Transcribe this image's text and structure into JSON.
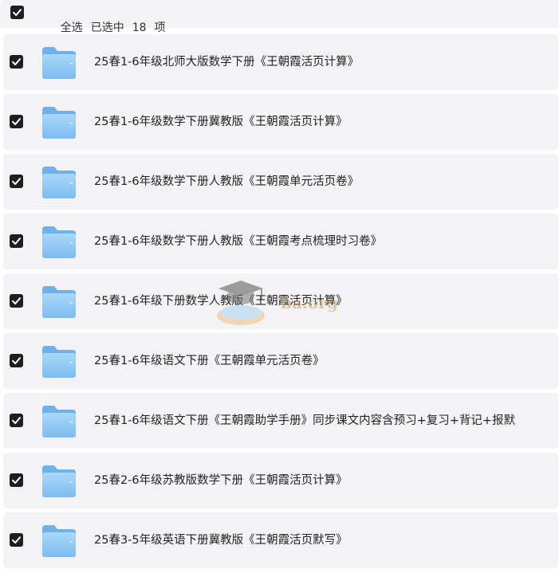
{
  "select_bar": {
    "select_all_label": "全选",
    "selected_prefix": "已选中",
    "selected_count": "18",
    "selected_suffix": "项",
    "checked": true
  },
  "items": [
    {
      "name": "25春1-6年级北师大版数学下册《王朝霞活页计算》",
      "type": "folder",
      "checked": true
    },
    {
      "name": "25春1-6年级数学下册冀教版《王朝霞活页计算》",
      "type": "folder",
      "checked": true
    },
    {
      "name": "25春1-6年级数学下册人教版《王朝霞单元活页卷》",
      "type": "folder",
      "checked": true
    },
    {
      "name": "25春1-6年级数学下册人教版《王朝霞考点梳理时习卷》",
      "type": "folder",
      "checked": true
    },
    {
      "name": "25春1-6年级下册数学人教版《王朝霞活页计算》",
      "type": "folder",
      "checked": true
    },
    {
      "name": "25春1-6年级语文下册《王朝霞单元活页卷》",
      "type": "folder",
      "checked": true
    },
    {
      "name": "25春1-6年级语文下册《王朝霞助学手册》同步课文内容含预习+复习+背记+报默",
      "type": "folder",
      "checked": true
    },
    {
      "name": "25春2-6年级苏教版数学下册《王朝霞活页计算》",
      "type": "folder",
      "checked": true
    },
    {
      "name": "25春3-5年级英语下册冀教版《王朝霞活页默写》",
      "type": "folder",
      "checked": true
    }
  ],
  "watermark": {
    "text": "ba.org",
    "icon": "graduation-cap-icon"
  },
  "colors": {
    "row_background": "#f3f3f5",
    "checkbox_fill": "#1e1e1e",
    "folder_blue": "#8cc8f5"
  }
}
